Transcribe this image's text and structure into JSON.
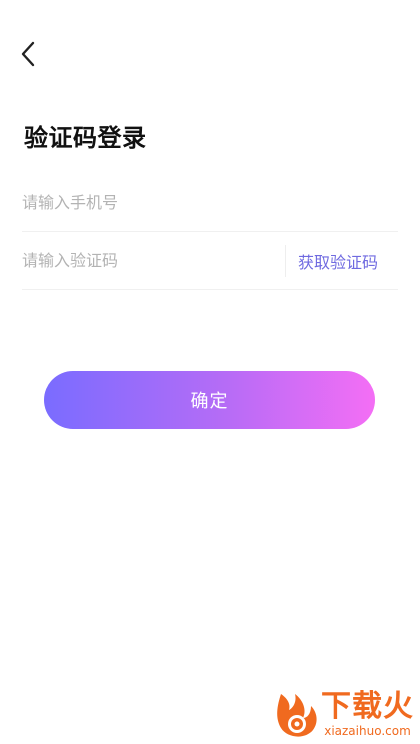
{
  "nav": {
    "back_icon": "chevron-left-icon"
  },
  "title": "验证码登录",
  "phone_field": {
    "placeholder": "请输入手机号",
    "value": ""
  },
  "code_field": {
    "placeholder": "请输入验证码",
    "value": ""
  },
  "get_code_label": "获取验证码",
  "confirm_label": "确定",
  "colors": {
    "accent_text": "#6f6ae0",
    "button_gradient_start": "#7a6cff",
    "button_gradient_end": "#f46ef5",
    "watermark": "#f06a1f"
  },
  "watermark": {
    "cn": "下载火",
    "en": "xiazaihuo.com"
  }
}
